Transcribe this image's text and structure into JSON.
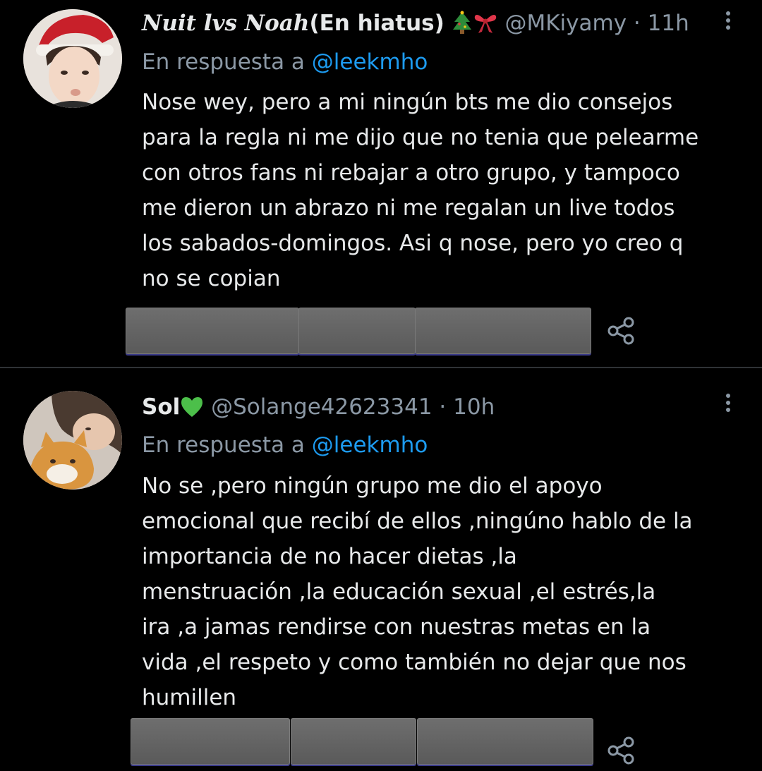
{
  "tweets": [
    {
      "display_name": "Nuit lvs Noah",
      "display_name_suffix": "(En hiatus)",
      "emojis": [
        "christmas-tree-emoji",
        "ribbon-emoji"
      ],
      "handle": "@MKiyamy",
      "separator": "·",
      "time": "11h",
      "reply_prefix": "En respuesta a",
      "reply_to": "@leekmho",
      "lines": [
        "Nose wey, pero a mi ningún bts me dio consejos",
        "para la regla ni me dijo que no tenia que pelearme",
        "con otros fans ni rebajar a otro grupo, y tampoco",
        "me dieron un abrazo ni me regalan un live todos",
        "los sabados-domingos. Asi q nose, pero yo creo q",
        "no se copian"
      ]
    },
    {
      "display_name": "Sol",
      "emojis": [
        "green-heart-emoji"
      ],
      "handle": "@Solange42623341",
      "separator": "·",
      "time": "10h",
      "reply_prefix": "En respuesta a",
      "reply_to": "@leekmho",
      "lines": [
        "No se ,pero ningún grupo me dio el apoyo",
        "emocional que recibí de ellos ,ningúno hablo de la",
        "importancia de no hacer dietas ,la",
        "menstruación ,la educación sexual ,el estrés,la",
        "ira ,a jamas rendirse con nuestras metas en la",
        "vida ,el respeto y como también no dejar que nos",
        "humillen"
      ]
    }
  ],
  "icons": {
    "more": "more-vertical-icon",
    "share": "share-icon"
  },
  "colors": {
    "background": "#000000",
    "text": "#e7e9ea",
    "muted": "#8b98a5",
    "link": "#1d9bf0",
    "divider": "#2f3336",
    "redaction": "#666666"
  }
}
